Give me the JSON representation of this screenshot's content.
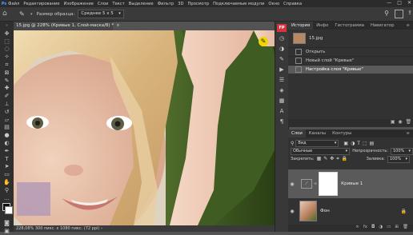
{
  "menu": {
    "logo": "Ps",
    "items": [
      "Файл",
      "Редактирование",
      "Изображение",
      "Слои",
      "Текст",
      "Выделение",
      "Фильтр",
      "3D",
      "Просмотр",
      "Подключаемые модули",
      "Окно",
      "Справка"
    ],
    "window_controls": [
      "—",
      "□",
      "✕"
    ]
  },
  "options": {
    "sample_size_label": "Размер образца:",
    "sample_size_value": "Среднее 5 х 5"
  },
  "document": {
    "tab_title": "15.jpg @ 228% (Кривые 1, Слой-маска/8) *",
    "close": "×",
    "status": "228,08%   300 пикс. х 1080 пикс. (72 ppi)  ›"
  },
  "right_strip": {
    "fp_label": "FP"
  },
  "history": {
    "tabs": [
      "История",
      "Инфо",
      "Гистограмма",
      "Навигатор"
    ],
    "snapshot_name": "15.jpg",
    "items": [
      "Открыть",
      "Новый слой \"Кривые\"",
      "Настройка слоя \"Кривые\""
    ],
    "active_index": 2
  },
  "layers": {
    "tabs": [
      "Слои",
      "Каналы",
      "Контуры"
    ],
    "filter_kind": "Вид",
    "blend_mode": "Обычные",
    "opacity_label": "Непрозрачность:",
    "opacity_value": "100%",
    "lock_label": "Закрепить:",
    "fill_label": "Заливка:",
    "fill_value": "100%",
    "items": [
      {
        "name": "Кривые 1",
        "type": "adjustment"
      },
      {
        "name": "Фон",
        "type": "background"
      }
    ],
    "selected_index": 0
  },
  "colors": {
    "accent_red": "#d3343f",
    "panel_bg": "#323232",
    "selected_row": "#5a5a5a"
  }
}
